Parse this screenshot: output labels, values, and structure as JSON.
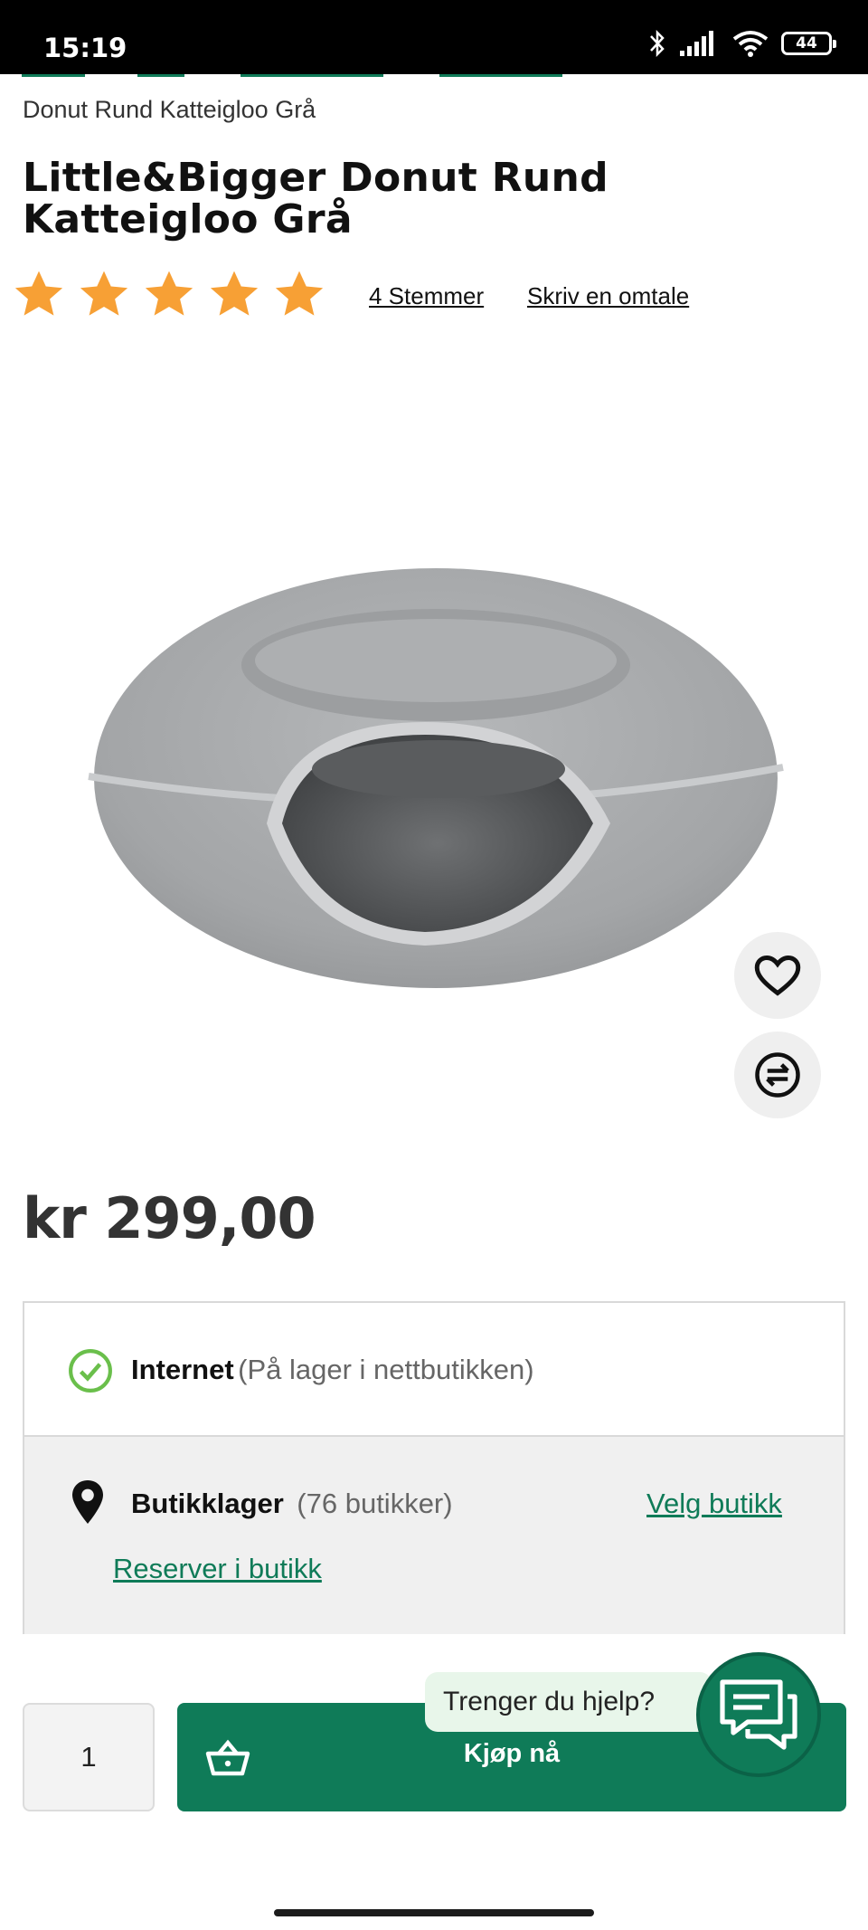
{
  "status_bar": {
    "time": "15:19",
    "battery": "44"
  },
  "breadcrumb": {
    "current": "Donut Rund Katteigloo Grå"
  },
  "product": {
    "title": "Little&Bigger Donut Rund Katteigloo Grå",
    "rating": 5,
    "votes_label": "4 Stemmer",
    "write_review_label": "Skriv en omtale",
    "price": "kr 299,00",
    "colors": {
      "felt": "#a7a9ab",
      "accent": "#0f7b58",
      "star": "#f7a035"
    }
  },
  "stock": {
    "internet_label": "Internet",
    "internet_note": "(På lager i nettbutikken)",
    "store_label": "Butikklager",
    "store_note": "(76 butikker)",
    "choose_store": "Velg butikk",
    "reserve": "Reserver i butikk"
  },
  "purchase": {
    "quantity": "1",
    "buy_label": "Kjøp nå"
  },
  "help": {
    "text": "Trenger du hjelp?"
  },
  "icons": [
    "heart-icon",
    "compare-icon",
    "check-circle-icon",
    "location-pin-icon",
    "basket-icon",
    "chat-icon"
  ]
}
